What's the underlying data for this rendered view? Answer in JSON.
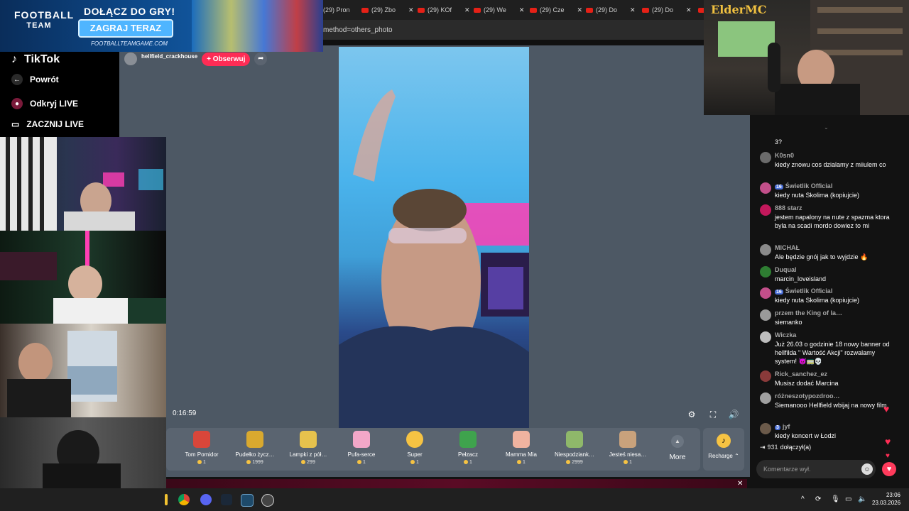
{
  "browser": {
    "tabs": [
      {
        "label": "(29) Pron"
      },
      {
        "label": "(29) Zbo"
      },
      {
        "label": "(29) KOf"
      },
      {
        "label": "(29) We"
      },
      {
        "label": "(29) Cze"
      },
      {
        "label": "(29) Do"
      },
      {
        "label": "(29) Do"
      }
    ],
    "url_fragment": "method=others_photo"
  },
  "ad": {
    "brand_line1": "FOOTBALL",
    "brand_line2": "TEAM",
    "headline": "DOŁĄCZ DO GRY!",
    "cta": "ZAGRAJ TERAZ",
    "url": "FOOTBALLTEAMGAME.COM"
  },
  "overlay": {
    "brand": "ElderMC"
  },
  "tiktok_sidebar": {
    "logo": "TikTok",
    "back": "Powrót",
    "discover_live": "Odkryj LIVE",
    "start_live": "ZACZNIJ LIVE"
  },
  "stream": {
    "username": "hellfield_crackhouse",
    "follow_label": "+ Obserwuj",
    "elapsed": "0:16:59"
  },
  "gifts": [
    {
      "name": "Tom Pomidor",
      "price": "1",
      "color": "#d9463a"
    },
    {
      "name": "Pudełko życz…",
      "price": "1999",
      "color": "#d9a92f"
    },
    {
      "name": "Lampki z pół…",
      "price": "299",
      "color": "#e6c24d"
    },
    {
      "name": "Pufa-serce",
      "price": "1",
      "color": "#f2a7c8"
    },
    {
      "name": "Super",
      "price": "1",
      "color": "#f6c343"
    },
    {
      "name": "Pełzacz",
      "price": "1",
      "color": "#3fa34d"
    },
    {
      "name": "Mamma Mia",
      "price": "1",
      "color": "#f0b3a0"
    },
    {
      "name": "Niespodziank…",
      "price": "2999",
      "color": "#8fb86a"
    },
    {
      "name": "Jesteś niesa…",
      "price": "1",
      "color": "#c9a27c"
    }
  ],
  "gift_more": "More",
  "recharge": "Recharge",
  "chat": {
    "partial_top": "3?",
    "messages": [
      {
        "user": "K0sn0",
        "badge": "",
        "text": "kiedy znowu cos dzialamy z miiulem co",
        "color": "#6b6b6b"
      },
      {
        "user": "Świetlik Official",
        "badge": "16",
        "text": "kiedy nuta Skolima (kopiujcie)",
        "color": "#c24f8a"
      },
      {
        "user": "888 starz",
        "badge": "",
        "text": "jestem napalony na nute z spazma ktora byla na scadi mordo dowiez to mi",
        "color": "#c2185b"
      },
      {
        "user": "MICHAŁ",
        "badge": "",
        "text": "Ale będzie gnój jak to wyjdzie 🔥",
        "color": "#8a8a8a"
      },
      {
        "user": "Duqual",
        "badge": "",
        "text": "marcin_loveisland",
        "color": "#2e7d32"
      },
      {
        "user": "Świetlik Official",
        "badge": "16",
        "text": "kiedy nuta Skolima (kopiujcie)",
        "color": "#c24f8a"
      },
      {
        "user": "przem the King of la…",
        "badge": "",
        "text": "siemanko",
        "color": "#9a9a9a"
      },
      {
        "user": "Wiczka",
        "badge": "",
        "text": "Już 26.03 o godzinie 18 nowy banner od hellfilda \" Wartość Akcji\" rozwalamy system! 👿🚃💀",
        "color": "#bdbdbd"
      },
      {
        "user": "Rick_sanchez_ez",
        "badge": "",
        "text": "Musisz dodać Marcina",
        "color": "#8a3a3a"
      },
      {
        "user": "różneszotypozdroo…",
        "badge": "",
        "text": "Siemanooo Hellfield wbijaj na nowy film",
        "color": "#a0a0a0"
      },
      {
        "user": "jyf",
        "badge": "3",
        "text": "kiedy koncert w Łodzi",
        "color": "#6b5a4a"
      }
    ],
    "joined_count": "931",
    "joined_label": "dołączył(a)",
    "input_placeholder": "Komentarze wył."
  },
  "taskbar": {
    "time": "23:06",
    "date": "23.03.2026"
  }
}
